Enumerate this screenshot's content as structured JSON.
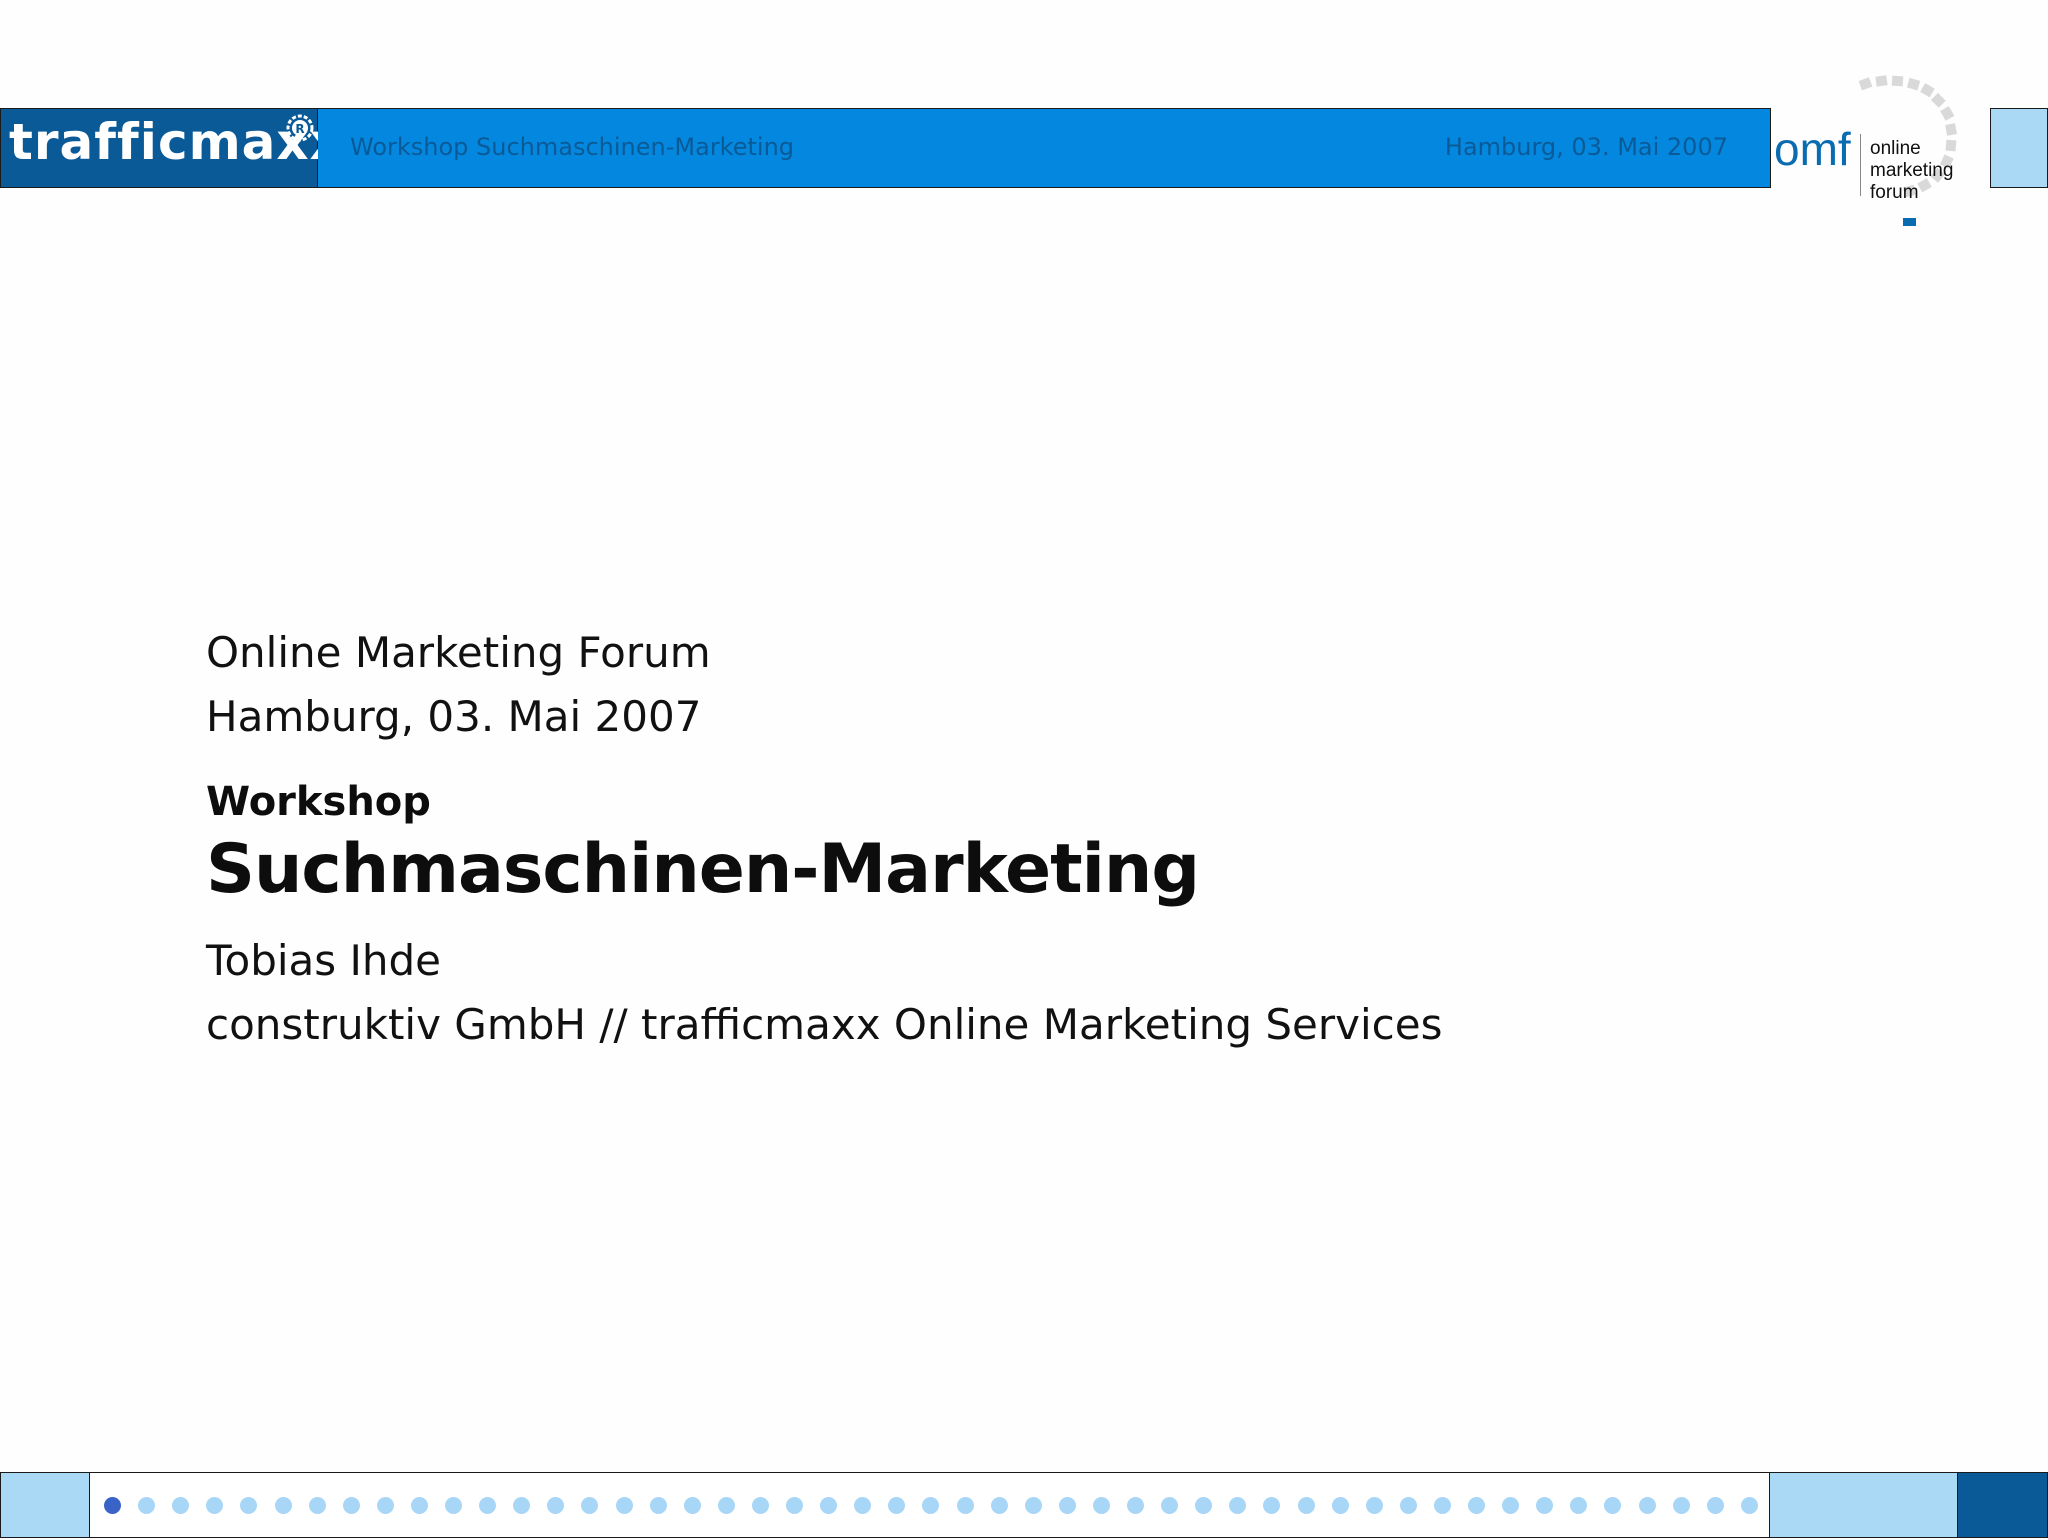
{
  "header": {
    "logo": "trafficmaxx",
    "registered_mark": "R",
    "title": "Workshop Suchmaschinen-Marketing",
    "date": "Hamburg, 03. Mai 2007",
    "omf_logo": {
      "abbr": "omf",
      "words": [
        "online",
        "marketing",
        "forum"
      ]
    }
  },
  "content": {
    "event": "Online Marketing Forum",
    "date": "Hamburg, 03. Mai 2007",
    "kicker": "Workshop",
    "title": "Suchmaschinen-Marketing",
    "speaker": "Tobias Ihde",
    "company": "construktiv GmbH // trafficmaxx Online Marketing Services"
  },
  "footer": {
    "slide_count": 50,
    "current_slide": 1
  },
  "colors": {
    "dark_blue": "#0a5a97",
    "bar_blue": "#0488df",
    "light_blue": "#aad9f5",
    "dot_inactive": "#a8d6f7",
    "dot_active": "#3a63c8"
  }
}
